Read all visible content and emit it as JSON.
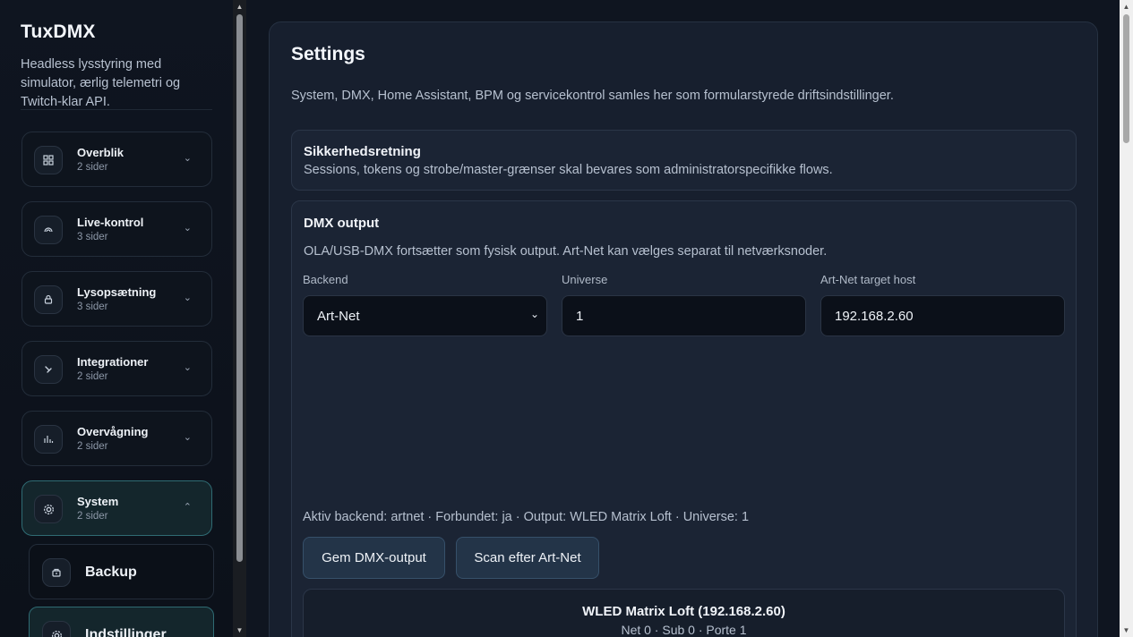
{
  "sidebar": {
    "brand": "TuxDMX",
    "tagline": "Headless lysstyring med simulator, ærlig telemetri og Twitch-klar API.",
    "groups": [
      {
        "title": "Overblik",
        "sub": "2 sider",
        "icon": "grid-icon"
      },
      {
        "title": "Live-kontrol",
        "sub": "3 sider",
        "icon": "signal-icon"
      },
      {
        "title": "Lysopsætning",
        "sub": "3 sider",
        "icon": "lamp-icon"
      },
      {
        "title": "Integrationer",
        "sub": "2 sider",
        "icon": "plug-icon"
      },
      {
        "title": "Overvågning",
        "sub": "2 sider",
        "icon": "bar-chart-icon"
      },
      {
        "title": "System",
        "sub": "2 sider",
        "icon": "gear-icon"
      }
    ],
    "subitems": [
      {
        "label": "Backup",
        "icon": "archive-icon"
      },
      {
        "label": "Indstillinger",
        "icon": "gear-icon"
      }
    ]
  },
  "main": {
    "title": "Settings",
    "description": "System, DMX, Home Assistant, BPM og servicekontrol samles her som formularstyrede driftsindstillinger.",
    "security": {
      "title": "Sikkerhedsretning",
      "text": "Sessions, tokens og strobe/master-grænser skal bevares som administratorspecifikke flows."
    },
    "dmx": {
      "title": "DMX output",
      "text": "OLA/USB-DMX fortsætter som fysisk output. Art-Net kan vælges separat til netværksnoder.",
      "backend_label": "Backend",
      "backend_value": "Art-Net",
      "universe_label": "Universe",
      "universe_value": "1",
      "host_label": "Art-Net target host",
      "host_value": "192.168.2.60",
      "status": "Aktiv backend: artnet · Forbundet: ja · Output: WLED Matrix Loft · Universe: 1",
      "save_button": "Gem DMX-output",
      "scan_button": "Scan efter Art-Net",
      "node_name": "WLED Matrix Loft (192.168.2.60)",
      "node_detail": "Net 0 · Sub 0 · Porte 1"
    }
  },
  "colors": {
    "accent_active_border": "#2f6b73",
    "panel_bg": "#171f2e"
  }
}
